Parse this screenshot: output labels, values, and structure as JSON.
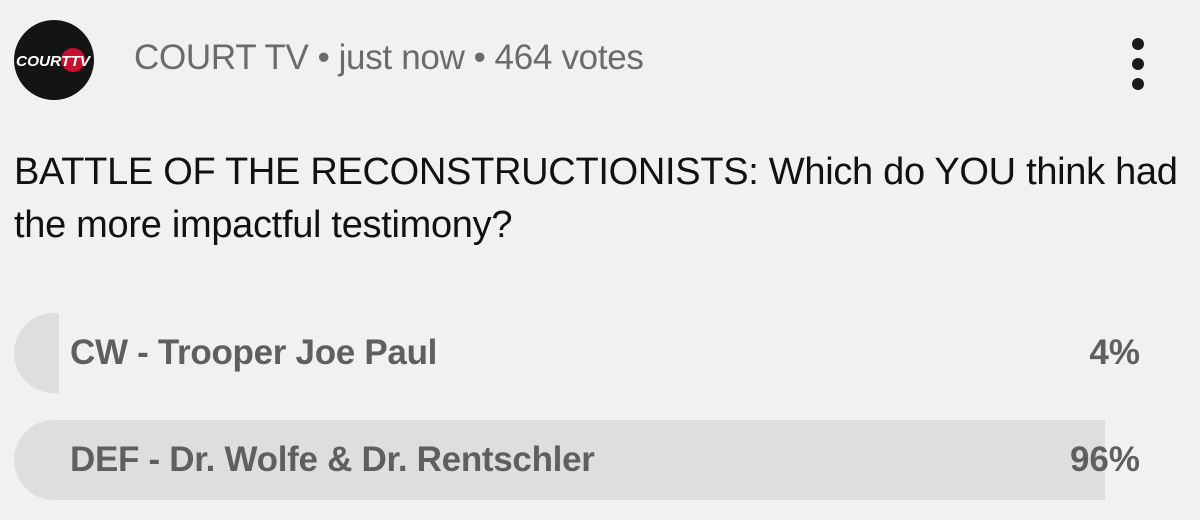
{
  "post": {
    "logo_text": "COURTTV",
    "channel": "COURT TV",
    "separator": "•",
    "time": "just now",
    "votes": "464 votes"
  },
  "icons": {
    "avatar": "court-tv-logo",
    "more": "vertical-ellipsis-icon"
  },
  "question": "BATTLE OF THE RECONSTRUCTIONISTS: Which do YOU think had the more impactful testimony?",
  "options": [
    {
      "label": "CW - Trooper Joe Paul",
      "percent_label": "4%",
      "percent": 4
    },
    {
      "label": "DEF - Dr. Wolfe & Dr. Rentschler",
      "percent_label": "96%",
      "percent": 96
    }
  ],
  "colors": {
    "background": "#f1f1f1",
    "bar": "#dedede",
    "text": "#111111",
    "muted_text": "#6b6b6b",
    "brand_red": "#c8102e"
  }
}
